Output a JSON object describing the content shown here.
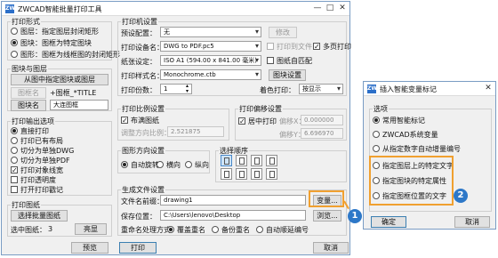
{
  "main_window": {
    "title": "ZWCAD智能批量打印工具",
    "app_icon": "ZW",
    "minimize": "—",
    "maximize": "□",
    "close": "✕",
    "print_form": {
      "title": "打印形式",
      "options": [
        "图层：指定图层封闭矩形",
        "图块：图框为特定图块",
        "图形：图框为线框图的封闭矩形"
      ],
      "selected": "图块：图框为特定图块"
    },
    "block_layer": {
      "title": "图块与图层",
      "pick_button": "从图中指定图块或图层",
      "block_name_button": "图框名",
      "block_name_hint": "+图框_*TITLE",
      "block_label_button": "图块名",
      "block_value": "大连图框"
    },
    "output": {
      "title": "打印输出选项",
      "options": [
        "直接打印",
        "打印已有布局",
        "切分为单独DWG",
        "切分为单独PDF"
      ],
      "selected": "直接打印",
      "checks": [
        {
          "label": "打印对象线宽",
          "checked": true
        },
        {
          "label": "打印透明度",
          "checked": false
        },
        {
          "label": "打开打印戳记",
          "checked": false
        }
      ]
    },
    "print_frames": {
      "title": "打印图纸",
      "select_button": "选择批量图纸",
      "selected_label": "选中图纸：",
      "selected_count": "3",
      "highlight_button": "亮显"
    },
    "print_settings": {
      "title": "打印机设置",
      "preset_label": "预设配置：",
      "preset_value": "无",
      "modify_button": "修改",
      "printer_label": "打印设备名：",
      "printer_value": "DWG to PDF.pc5",
      "print_to_file": "打印到文件",
      "multi_page_pdf": "多页打印",
      "paper_label": "纸张设定：",
      "paper_value": "ISO A1 (594.00 x 841.00 毫米)",
      "auto_match": "图纸自匹配",
      "style_label": "打印样式名：",
      "style_value": "Monochrome.ctb",
      "style_button": "图块设置",
      "copies_label": "打印份数：",
      "copies_value": "1",
      "color_label": "着色打印：",
      "color_value": "按显示"
    },
    "scale": {
      "title": "打印比例设置",
      "fit_label": "布满图纸",
      "fit_checked": true,
      "direction_label": "调整方向比例：",
      "direction_value": "2.521875"
    },
    "offset": {
      "title": "打印偏移设置",
      "center_label": "居中打印",
      "center_checked": true,
      "offset_x_label": "偏移X：",
      "offset_x_value": "0.000000",
      "offset_y_label": "偏移Y：",
      "offset_y_value": "6.696970"
    },
    "orientation": {
      "title": "图形方向设置",
      "options": [
        "自动旋转",
        "横向",
        "纵向"
      ],
      "selected": "自动旋转"
    },
    "order": {
      "title": "选择顺序"
    },
    "file_settings": {
      "title": "生成文件设置",
      "prefix_label": "文件名前缀：",
      "prefix_value": "drawing1",
      "variable_button": "变量...",
      "save_label": "保存位置：",
      "save_value": "C:\\Users\\lenovo\\Desktop",
      "browse_button": "浏览...",
      "rename_label": "重命名处理方式：",
      "rename_options": [
        "覆盖重名",
        "备份重名",
        "自动顺延编号"
      ],
      "rename_selected": "自动顺延编号"
    },
    "bottom": {
      "preview": "预览",
      "print": "打印",
      "cancel": "取消"
    }
  },
  "dialog": {
    "title": "插入智能变量标记",
    "close": "✕",
    "group_title": "选项",
    "options": [
      "常用智能标记",
      "ZWCAD系统变量",
      "从指定数字自动增量编号",
      "指定图层上的特定文字",
      "指定图块的特定属性",
      "指定图框位置的文字"
    ],
    "selected": "常用智能标记",
    "ok": "确定",
    "cancel": "取消"
  },
  "markers": {
    "first": "1",
    "second": "2"
  },
  "colors": {
    "highlight": "#f0a030",
    "marker": "#2d78c8",
    "window_border": "#7a9cc4"
  }
}
